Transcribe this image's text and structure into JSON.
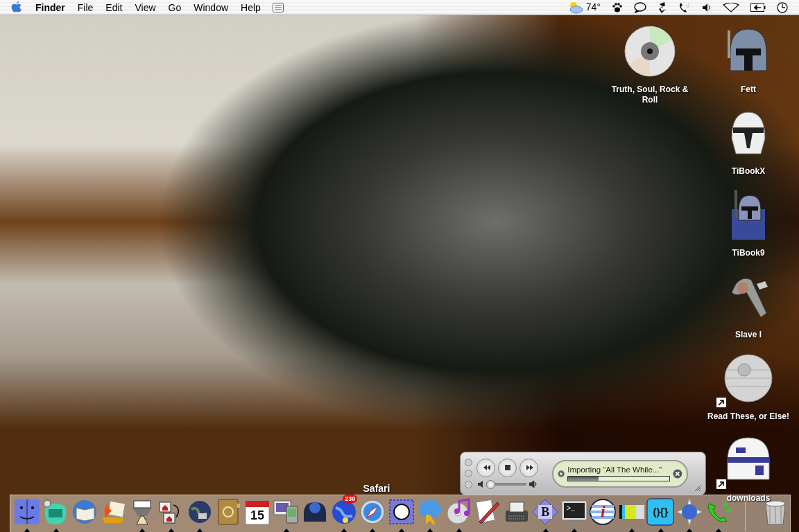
{
  "menu_bar": {
    "app": "Finder",
    "menus": [
      "File",
      "Edit",
      "View",
      "Go",
      "Window",
      "Help"
    ],
    "temperature": "74°"
  },
  "desktop_icons": [
    {
      "label": "Truth, Soul, Rock & Roll",
      "alias": false
    },
    {
      "label": "Fett",
      "alias": false
    },
    {
      "label": "TiBookX",
      "alias": false
    },
    {
      "label": "TiBook9",
      "alias": false
    },
    {
      "label": "Slave I",
      "alias": false
    },
    {
      "label": "Read These, or Else!",
      "alias": true
    },
    {
      "label": "downloads",
      "alias": true
    }
  ],
  "mini_player": {
    "status": "Importing “All The While...”",
    "progress": {
      "level": 0.3
    },
    "volume": {
      "level": 0.12
    }
  },
  "dock": {
    "tooltip": "Safari",
    "items": [
      {
        "running": true
      },
      {
        "running": true
      },
      {
        "running": false
      },
      {
        "running": false
      },
      {
        "running": true
      },
      {
        "running": true
      },
      {
        "running": true
      },
      {
        "running": false
      },
      {
        "running": false,
        "icon_text": "15"
      },
      {
        "running": true
      },
      {
        "running": false
      },
      {
        "running": true,
        "badge": "239"
      },
      {
        "running": true
      },
      {
        "running": true
      },
      {
        "running": true
      },
      {
        "running": true
      },
      {
        "running": false
      },
      {
        "running": false
      },
      {
        "running": true,
        "icon_text": "B"
      },
      {
        "running": true,
        "icon_text": ">_"
      },
      {
        "running": false,
        "icon_text": "i"
      },
      {
        "running": true
      },
      {
        "running": true,
        "icon_text": "(){}"
      },
      {
        "running": true
      },
      {
        "running": true
      },
      {
        "running": false
      }
    ]
  }
}
